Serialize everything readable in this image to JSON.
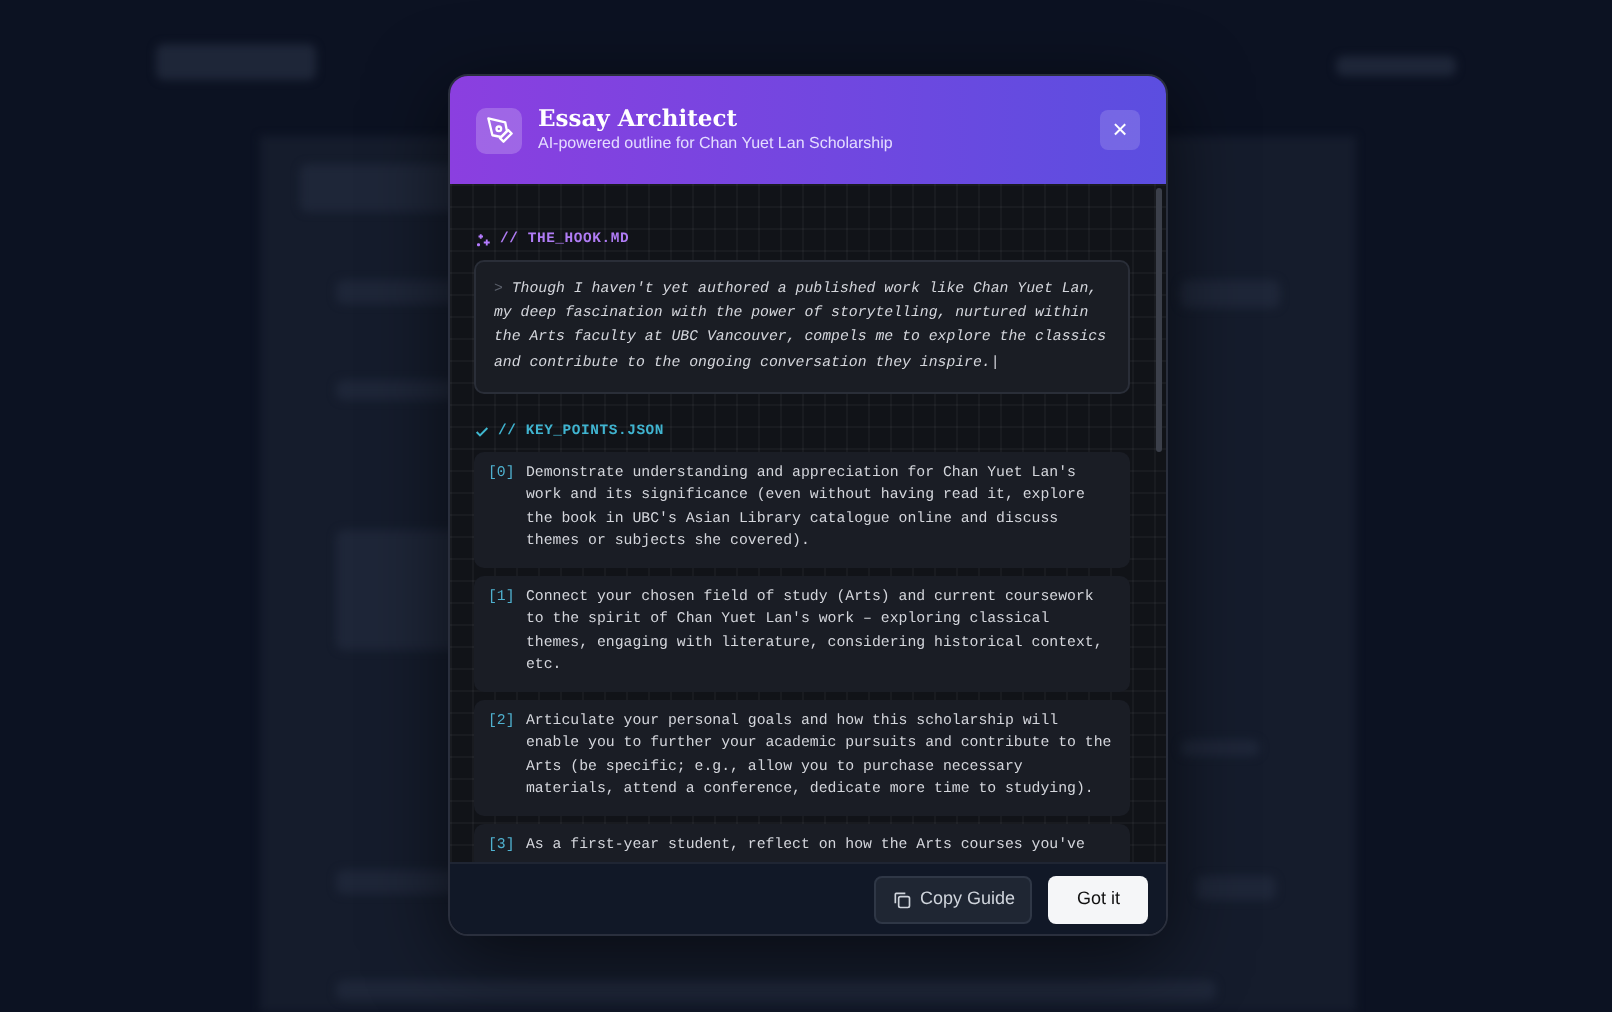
{
  "dialog": {
    "title": "Essay Architect",
    "subtitle": "AI-powered outline for Chan Yuet Lan Scholarship",
    "close": "×",
    "hook": {
      "label": "// THE_HOOK.MD",
      "prompt": ">",
      "text": "Though I haven't yet authored a published work like Chan Yuet Lan, my deep fascination with the power of storytelling, nurtured within the Arts faculty at UBC Vancouver, compels me to explore the classics and contribute to the ongoing conversation they inspire.|"
    },
    "key_points": {
      "label": "// KEY_POINTS.JSON",
      "items": [
        {
          "index": "[0]",
          "text": "Demonstrate understanding and appreciation for Chan Yuet Lan's work and its significance (even without having read it, explore the book in UBC's Asian Library catalogue online and discuss themes or subjects she covered)."
        },
        {
          "index": "[1]",
          "text": "Connect your chosen field of study (Arts) and current coursework to the spirit of Chan Yuet Lan's work – exploring classical themes, engaging with literature, considering historical context, etc."
        },
        {
          "index": "[2]",
          "text": "Articulate your personal goals and how this scholarship will enable you to further your academic pursuits and contribute to the Arts (be specific; e.g., allow you to purchase necessary materials, attend a conference, dedicate more time to studying)."
        },
        {
          "index": "[3]",
          "text": "As a first-year student, reflect on how the Arts courses you've"
        }
      ]
    },
    "buttons": [
      {
        "kind": "secondary",
        "label": "Copy Guide"
      },
      {
        "kind": "primary",
        "label": "Got it"
      }
    ]
  }
}
